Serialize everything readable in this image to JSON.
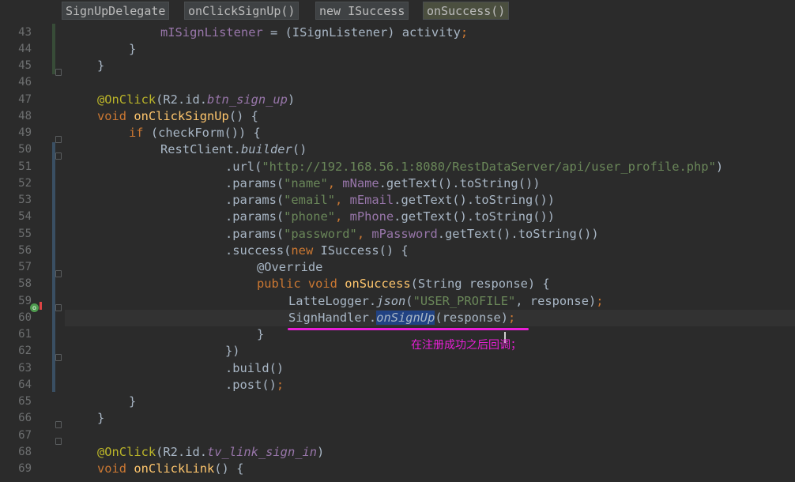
{
  "breadcrumbs": [
    {
      "label": "SignUpDelegate",
      "active": false
    },
    {
      "label": "onClickSignUp()",
      "active": false
    },
    {
      "label": "new ISuccess",
      "active": false
    },
    {
      "label": "onSuccess()",
      "active": true
    }
  ],
  "line_numbers": [
    "43",
    "44",
    "45",
    "46",
    "47",
    "48",
    "49",
    "50",
    "51",
    "52",
    "53",
    "54",
    "55",
    "56",
    "57",
    "58",
    "59",
    "60",
    "61",
    "62",
    "63",
    "64",
    "65",
    "66",
    "67",
    "68",
    "69"
  ],
  "code": {
    "l43": {
      "field": "mISignListener",
      "rest": " = (ISignListener) activity",
      "semi": ";"
    },
    "l44": "}",
    "l45": "}",
    "l47": {
      "ann": "@OnClick",
      "p1": "(R2.id.",
      "fld": "btn_sign_up",
      "p2": ")"
    },
    "l48": {
      "kw": "void ",
      "meth": "onClickSignUp",
      "rest": "() {"
    },
    "l49": {
      "kw": "if ",
      "rest": "(checkForm()) {"
    },
    "l50": {
      "a": "RestClient.",
      "i": "builder",
      "b": "()"
    },
    "l51": {
      "a": ".url(",
      "s": "\"http://192.168.56.1:8080/RestDataServer/api/user_profile.php\"",
      "b": ")"
    },
    "l52": {
      "a": ".params(",
      "s": "\"name\"",
      "c": ", ",
      "f": "mName",
      "b": ".getText().toString())"
    },
    "l53": {
      "a": ".params(",
      "s": "\"email\"",
      "c": ", ",
      "f": "mEmail",
      "b": ".getText().toString())"
    },
    "l54": {
      "a": ".params(",
      "s": "\"phone\"",
      "c": ", ",
      "f": "mPhone",
      "b": ".getText().toString())"
    },
    "l55": {
      "a": ".params(",
      "s": "\"password\"",
      "c": ", ",
      "f": "mPassword",
      "b": ".getText().toString())"
    },
    "l56": {
      "a": ".success(",
      "kw": "new ",
      "b": "ISuccess() {"
    },
    "l57": "@Override",
    "l58": {
      "kw": "public void ",
      "meth": "onSuccess",
      "b": "(String response) {"
    },
    "l59": {
      "a": "LatteLogger.",
      "i": "json",
      "p": "(",
      "s": "\"USER_PROFILE\"",
      "b": ", response)",
      "semi": ";"
    },
    "l60": {
      "a": "SignHandler.",
      "sel": "onSignUp",
      "b": "(response)",
      "semi": ";"
    },
    "l61": "}",
    "l62": "})",
    "l63": ".build()",
    "l64": {
      "a": ".post()",
      "semi": ";"
    },
    "l65": "}",
    "l66": "}",
    "l68": {
      "ann": "@OnClick",
      "p1": "(R2.id.",
      "fld": "tv_link_sign_in",
      "p2": ")"
    },
    "l69": {
      "kw": "void ",
      "meth": "onClickLink",
      "rest": "() {"
    }
  },
  "annotation_note": "在注册成功之后回调；",
  "colors": {
    "background": "#2b2b2b",
    "keyword": "#cc7832",
    "annotation": "#bbb529",
    "string": "#6a8759",
    "field": "#9876aa",
    "method_decl": "#ffc66d",
    "default_text": "#a9b7c6",
    "handwritten_mark": "#e81fd6"
  },
  "icons": [
    "lightbulb-icon",
    "override-icon",
    "fold-icon"
  ]
}
